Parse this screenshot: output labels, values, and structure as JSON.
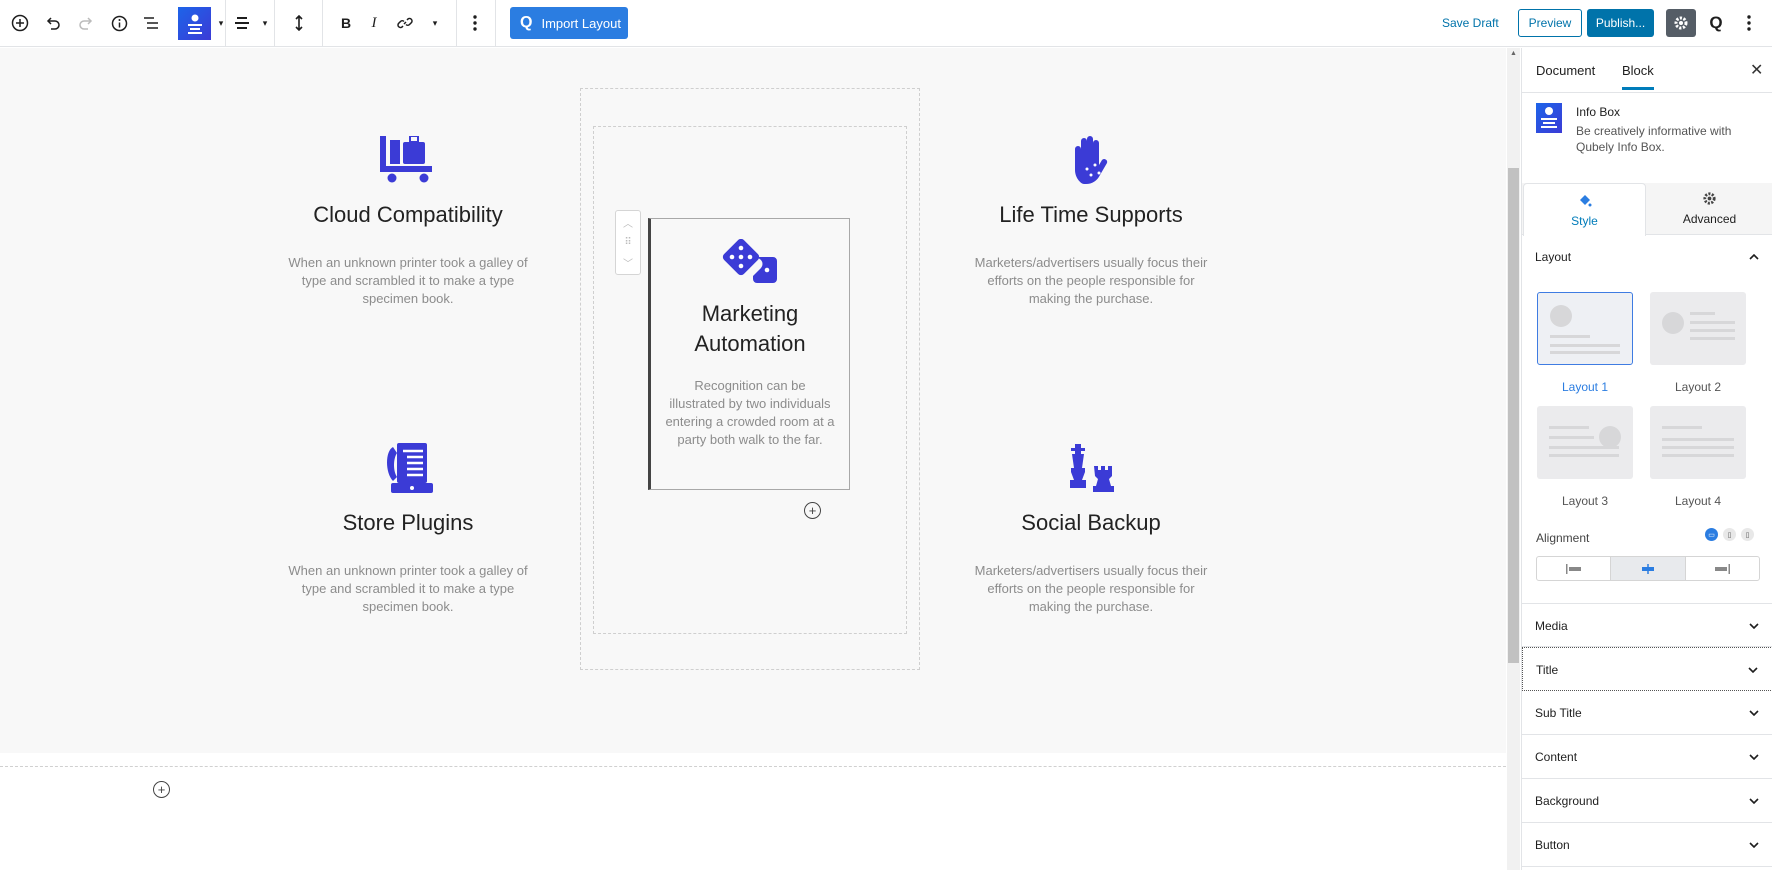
{
  "toolbar": {
    "import_label": "Import Layout",
    "save_draft": "Save Draft",
    "preview": "Preview",
    "publish": "Publish...",
    "bold": "B",
    "italic": "I"
  },
  "features": [
    {
      "title": "Cloud Compatibility",
      "text": "When an unknown printer took a galley of type and scrambled it to make a type specimen book.",
      "icon": "luggage-cart-icon"
    },
    {
      "title": "Life Time Supports",
      "text": "Marketers/advertisers usually focus their efforts on the people responsible for making the purchase.",
      "icon": "hand-sparkles-icon"
    },
    {
      "title": "Store Plugins",
      "text": "When an unknown printer took a galley of type and scrambled it to make a type specimen book.",
      "icon": "fax-icon"
    },
    {
      "title": "Social Backup",
      "text": "Marketers/advertisers usually focus their efforts on the people responsible for making the purchase.",
      "icon": "chess-icon"
    }
  ],
  "selected_block": {
    "title": "Marketing Automation",
    "text": "Recognition can be illustrated by two individuals entering a crowded room at a party both walk to the far.",
    "icon": "dice-icon"
  },
  "sidebar": {
    "tabs": [
      "Document",
      "Block"
    ],
    "active_tab": "Block",
    "block_name": "Info Box",
    "block_desc": "Be creatively informative with Qubely Info Box.",
    "style_tabs": [
      "Style",
      "Advanced"
    ],
    "layout_heading": "Layout",
    "layouts": [
      "Layout 1",
      "Layout 2",
      "Layout 3",
      "Layout 4"
    ],
    "selected_layout": "Layout 1",
    "alignment_label": "Alignment",
    "panels": [
      "Media",
      "Title",
      "Sub Title",
      "Content",
      "Background",
      "Button"
    ]
  },
  "colors": {
    "accent": "#3b3bd6",
    "primary": "#0073aa"
  }
}
